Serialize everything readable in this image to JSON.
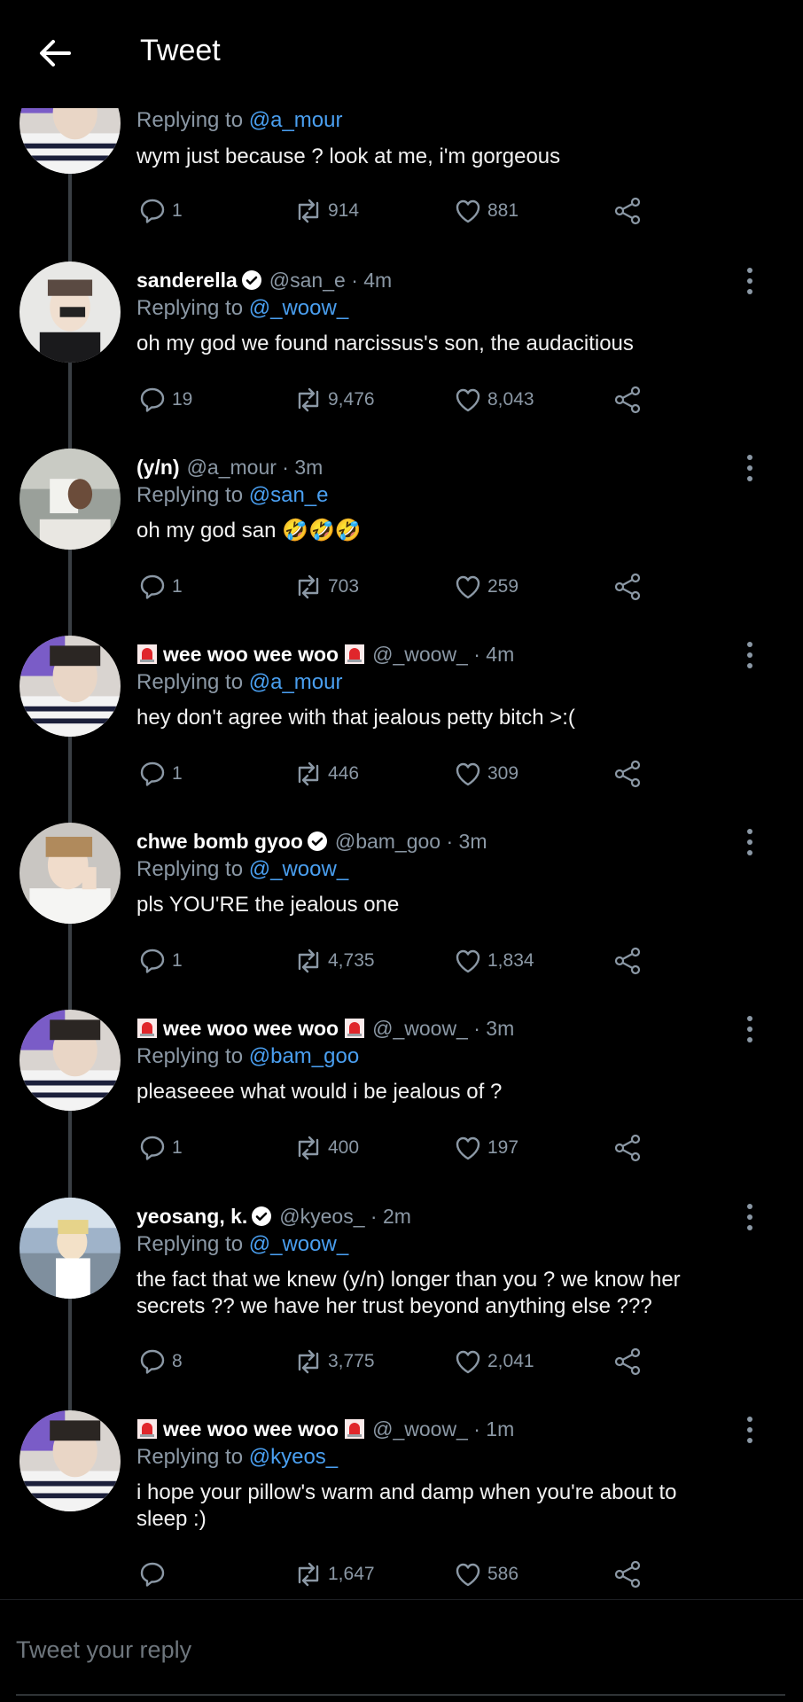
{
  "header": {
    "title": "Tweet"
  },
  "tweets": [
    {
      "name": "",
      "handle": "",
      "time": "",
      "verified": false,
      "siren": false,
      "replying_prefix": "Replying to ",
      "replying_to": "@a_mour",
      "text": "wym just because ? look at me, i'm gorgeous",
      "replies": "1",
      "retweets": "914",
      "likes": "881"
    },
    {
      "name": "sanderella",
      "handle": "@san_e · 4m",
      "verified": true,
      "siren": false,
      "replying_prefix": "Replying to ",
      "replying_to": "@_woow_",
      "text": "oh my god we found narcissus's son, the audacitious",
      "replies": "19",
      "retweets": "9,476",
      "likes": "8,043"
    },
    {
      "name": "(y/n)",
      "handle": "@a_mour · 3m",
      "verified": false,
      "siren": false,
      "replying_prefix": "Replying to ",
      "replying_to": "@san_e",
      "text": "oh my god san 🤣🤣🤣",
      "replies": "1",
      "retweets": "703",
      "likes": "259"
    },
    {
      "name": "wee woo wee woo",
      "handle": "@_woow_ · 4m",
      "verified": false,
      "siren": true,
      "replying_prefix": "Replying to ",
      "replying_to": "@a_mour",
      "text": "hey don't agree with that jealous petty bitch >:(",
      "replies": "1",
      "retweets": "446",
      "likes": "309"
    },
    {
      "name": "chwe bomb gyoo",
      "handle": "@bam_goo · 3m",
      "verified": true,
      "siren": false,
      "replying_prefix": "Replying to ",
      "replying_to": "@_woow_",
      "text": "pls YOU'RE the jealous one",
      "replies": "1",
      "retweets": "4,735",
      "likes": "1,834"
    },
    {
      "name": "wee woo wee woo",
      "handle": "@_woow_ · 3m",
      "verified": false,
      "siren": true,
      "replying_prefix": "Replying to ",
      "replying_to": "@bam_goo",
      "text": "pleaseeee what would i be jealous of ?",
      "replies": "1",
      "retweets": "400",
      "likes": "197"
    },
    {
      "name": "yeosang, k.",
      "handle": "@kyeos_ · 2m",
      "verified": true,
      "siren": false,
      "replying_prefix": "Replying to ",
      "replying_to": "@_woow_",
      "text": "the fact that we knew (y/n) longer than you ? we know her secrets ?? we have her trust beyond anything else ???",
      "replies": "8",
      "retweets": "3,775",
      "likes": "2,041"
    },
    {
      "name": "wee woo wee woo",
      "handle": "@_woow_ · 1m",
      "verified": false,
      "siren": true,
      "replying_prefix": "Replying to ",
      "replying_to": "@kyeos_",
      "text": "i hope your pillow's warm and damp when you're about to sleep :)",
      "replies": "",
      "retweets": "1,647",
      "likes": "586"
    }
  ],
  "reply_bar": {
    "placeholder": "Tweet your reply"
  },
  "colors": {
    "background": "#000000",
    "mention": "#4a9ff0",
    "muted": "#8b98a5",
    "rail": "#3a3f44"
  }
}
